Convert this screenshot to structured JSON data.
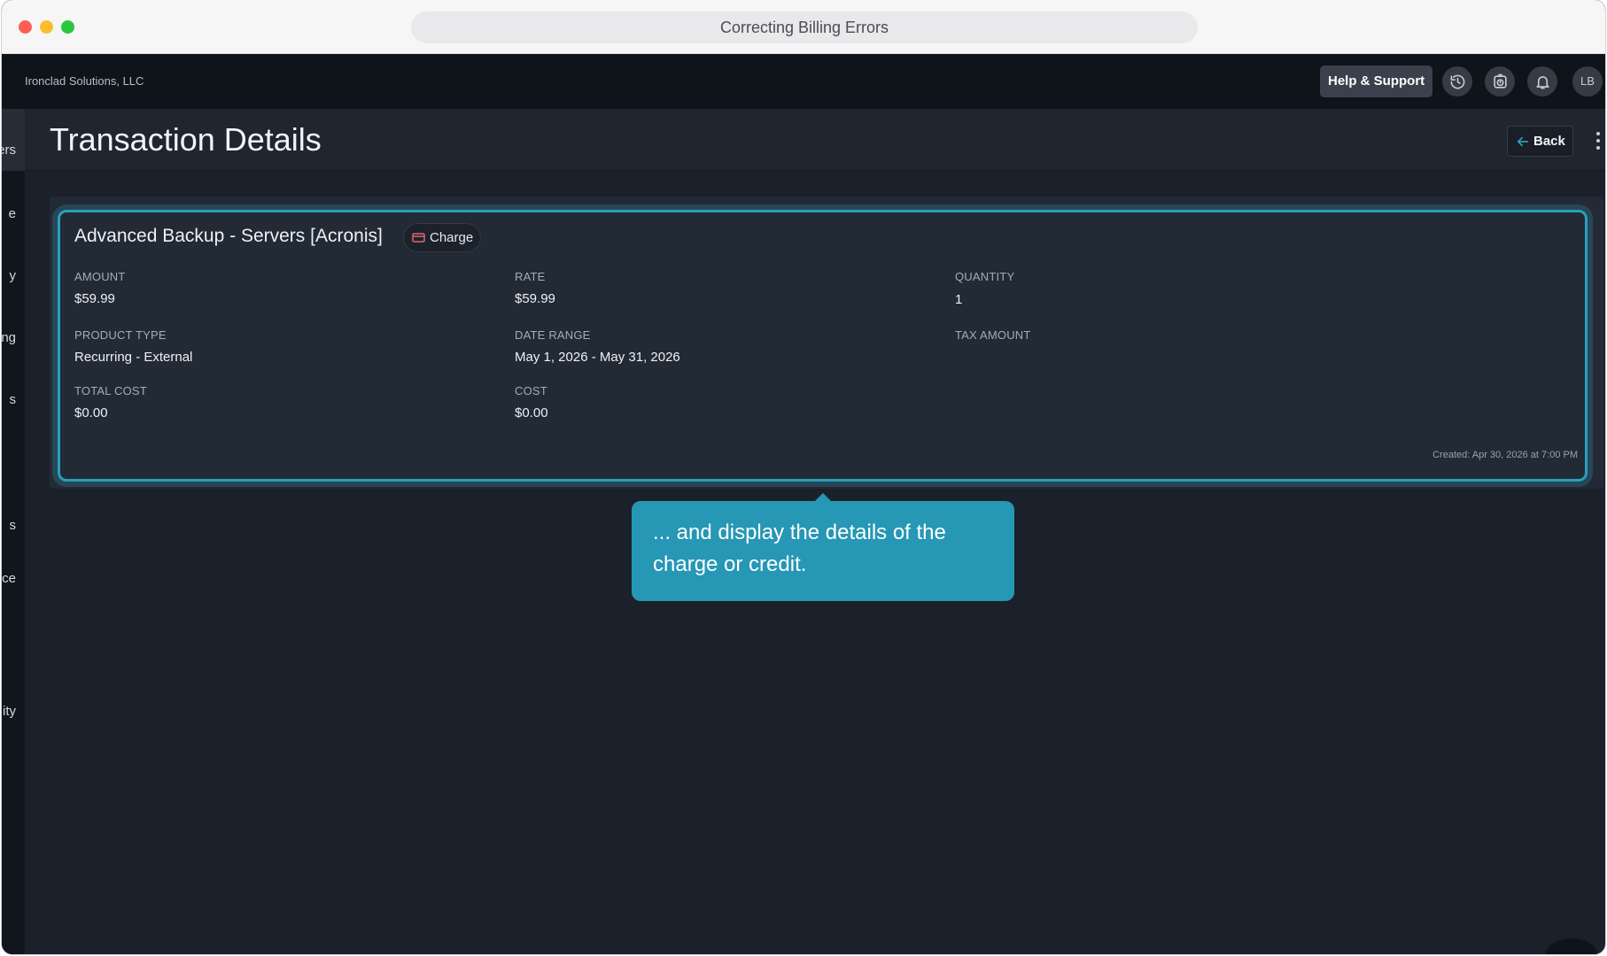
{
  "window": {
    "title": "Correcting Billing Errors"
  },
  "header": {
    "company": "Ironclad Solutions, LLC",
    "help_label": "Help & Support",
    "icons": [
      "history-icon",
      "timer-icon",
      "bell-icon"
    ],
    "avatar_initials": "LB"
  },
  "sidebar": {
    "items": [
      {
        "label": "ers",
        "active": true
      },
      {
        "label": "e"
      },
      {
        "label": "y"
      },
      {
        "label": "ng"
      },
      {
        "label": "s"
      },
      {
        "label": "s"
      },
      {
        "label": "ce"
      },
      {
        "label": "ity"
      }
    ]
  },
  "page": {
    "title": "Transaction Details",
    "back_label": "Back"
  },
  "transaction": {
    "name": "Advanced Backup - Servers [Acronis]",
    "type_badge": "Charge",
    "fields": {
      "amount": {
        "label": "AMOUNT",
        "value": "$59.99"
      },
      "rate": {
        "label": "RATE",
        "value": "$59.99"
      },
      "quantity": {
        "label": "QUANTITY",
        "value": "1"
      },
      "product_type": {
        "label": "PRODUCT TYPE",
        "value": "Recurring - External"
      },
      "date_range": {
        "label": "DATE RANGE",
        "value": "May 1, 2026 - May 31, 2026"
      },
      "tax_amount": {
        "label": "TAX AMOUNT",
        "value": ""
      },
      "total_cost": {
        "label": "TOTAL COST",
        "value": "$0.00"
      },
      "cost": {
        "label": "COST",
        "value": "$0.00"
      }
    },
    "created": "Created: Apr 30, 2026 at 7:00 PM"
  },
  "tooltip": {
    "text": "... and display the details of the charge or credit."
  },
  "colors": {
    "accent": "#2a9ebd",
    "tooltip_bg": "#2697b5",
    "badge_icon": "#e0656f"
  }
}
